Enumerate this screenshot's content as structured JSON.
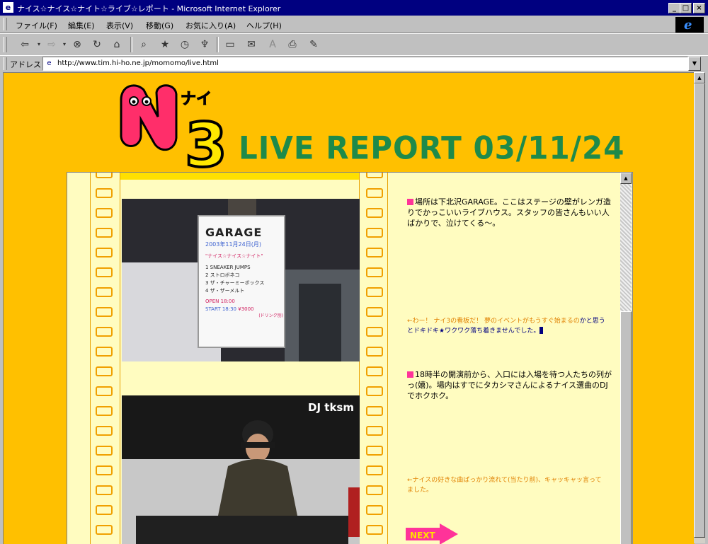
{
  "window": {
    "title": "ナイス☆ナイス☆ナイト☆ライブ☆レポート - Microsoft Internet Explorer",
    "buttons": {
      "minimize": "_",
      "maximize": "□",
      "close": "×"
    }
  },
  "menu": [
    "ファイル(F)",
    "編集(E)",
    "表示(V)",
    "移動(G)",
    "お気に入り(A)",
    "ヘルプ(H)"
  ],
  "address": {
    "label": "アドレス",
    "url": "http://www.tim.hi-ho.ne.jp/momomo/live.html"
  },
  "page": {
    "logo_text": "ナイ",
    "logo_number": "3",
    "title": "LIVE REPORT  03/11/24",
    "entries": [
      {
        "text": "場所は下北沢GARAGE。ここはステージの壁がレンガ造りでかっこいいライブハウス。スタッフの皆さんもいい人ばかりで、泣けてくる〜。",
        "note_orange": "←わー！ ナイ3の看板だ！ 夢のイベントがもうすぐ始まるの",
        "note_navy": "かと思うとドキドキ★ワクワク落ち着きませんでした。"
      },
      {
        "text": "18時半の開演前から、入口には入場を待つ人たちの列がっ(嬉)。場内はすでにタカシマさんによるナイス選曲のDJでホクホク。",
        "note_orange": "←ナイスの好きな曲ばっかり流れて(当たり前)、キャッキャッ言ってました。"
      }
    ],
    "sign": {
      "heading": "GARAGE",
      "date": "2003年11月24日(月)",
      "event": "\"ナイス☆ナイス☆ナイト\"",
      "lineup": [
        "1  SNEAKER JUMPS",
        "2  ストロボネコ",
        "3  ザ・チャーミーボックス",
        "4  ザ・ザーメルト"
      ],
      "open": "OPEN 18:00",
      "start": "START 18:30",
      "price_adv": "¥3000",
      "price_door": "(ドリンク別)"
    },
    "photo2_caption": "DJ tksm",
    "next_label": "NEXT"
  },
  "colors": {
    "page_bg": "#ffc000",
    "frame_bg": "#fffcc0",
    "title_green": "#1e8a4a",
    "film_orange": "#f0a000",
    "accent_pink": "#ff3399"
  }
}
